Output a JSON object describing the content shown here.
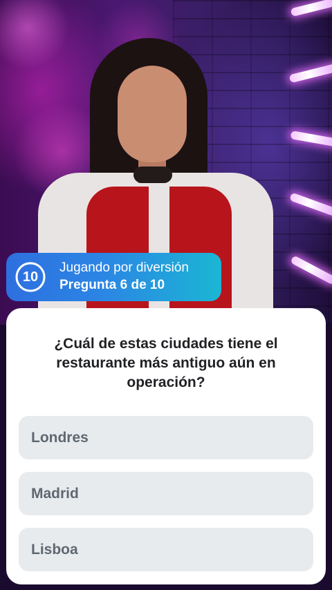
{
  "progress": {
    "timer_value": "10",
    "timer_fraction": 1.0,
    "mode_label": "Jugando por diversión",
    "question_counter": "Pregunta 6 de 10"
  },
  "question": {
    "text": "¿Cuál de estas ciudades tiene el restaurante más antiguo aún en operación?"
  },
  "answers": [
    {
      "label": "Londres"
    },
    {
      "label": "Madrid"
    },
    {
      "label": "Lisboa"
    }
  ],
  "colors": {
    "chip_gradient_start": "#2e6fe0",
    "chip_gradient_end": "#1bb6d4",
    "answer_background": "#e8ebee",
    "answer_text": "#5f6770",
    "question_text": "#202124"
  }
}
